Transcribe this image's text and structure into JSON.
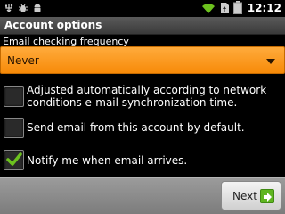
{
  "status_bar": {
    "time": "12:12",
    "icons": [
      "usb-icon",
      "bug-icon",
      "android-icon",
      "wifi-icon",
      "sd-card-icon",
      "battery-icon"
    ]
  },
  "title": "Account options",
  "frequency": {
    "label": "Email checking frequency",
    "selected": "Never"
  },
  "options": [
    {
      "label": "Adjusted automatically according to network conditions e-mail synchronization time.",
      "checked": false
    },
    {
      "label": "Send email from this account by default.",
      "checked": false
    },
    {
      "label": "Notify me when email arrives.",
      "checked": true
    }
  ],
  "footer": {
    "next_label": "Next"
  },
  "colors": {
    "accent": "#f7990f",
    "check": "#6cc11e",
    "next_icon": "#5fb520"
  }
}
